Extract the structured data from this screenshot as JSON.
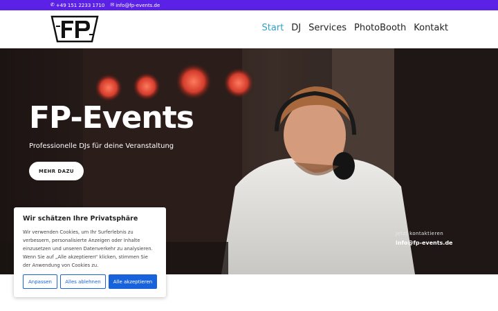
{
  "topbar": {
    "phone": "+49 151 2233 1710",
    "email": "info@fp-events.de",
    "phone_icon": "phone-icon",
    "mail_icon": "mail-icon",
    "color": "#5b21e6"
  },
  "header": {
    "logo_text": "FP",
    "nav": [
      {
        "label": "Start",
        "active": true
      },
      {
        "label": "DJ"
      },
      {
        "label": "Services"
      },
      {
        "label": "PhotoBooth"
      },
      {
        "label": "Kontakt"
      }
    ],
    "active_color": "#2ea3c7"
  },
  "hero": {
    "title": "FP-Events",
    "subtitle": "Professionelle DJs für deine Veranstaltung",
    "cta_label": "MEHR DAZU",
    "contact_label": "Jetzt kontaktieren",
    "contact_email": "info@fp-events.de"
  },
  "cookie": {
    "title": "Wir schätzen Ihre Privatsphäre",
    "text": "Wir verwenden Cookies, um Ihr Surferlebnis zu verbessern, personalisierte Anzeigen oder Inhalte einzusetzen und unseren Datenverkehr zu analysieren. Wenn Sie auf „Alle akzeptieren“ klicken, stimmen Sie der Anwendung von Cookies zu.",
    "btn_customize": "Anpassen",
    "btn_reject": "Alles ablehnen",
    "btn_accept": "Alle akzeptieren",
    "accent": "#1863dc"
  }
}
